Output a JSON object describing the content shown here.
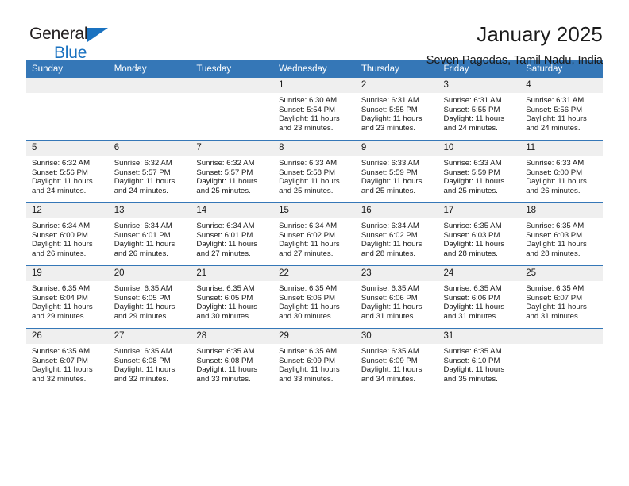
{
  "brand": {
    "line1": "General",
    "line2": "Blue",
    "mark": "triangle-logo"
  },
  "header": {
    "title": "January 2025",
    "subtitle": "Seven Pagodas, Tamil Nadu, India"
  },
  "colors": {
    "header_blue": "#3577b7",
    "daynum_gray": "#efefef",
    "brand_blue": "#1a72c0",
    "text": "#1a1a1a"
  },
  "weekday_headers": [
    "Sunday",
    "Monday",
    "Tuesday",
    "Wednesday",
    "Thursday",
    "Friday",
    "Saturday"
  ],
  "labels": {
    "sunrise": "Sunrise:",
    "sunset": "Sunset:",
    "daylight": "Daylight:"
  },
  "weeks": [
    [
      {
        "day": "",
        "empty": true
      },
      {
        "day": "",
        "empty": true
      },
      {
        "day": "",
        "empty": true
      },
      {
        "day": "1",
        "sunrise": "Sunrise: 6:30 AM",
        "sunset": "Sunset: 5:54 PM",
        "daylight": "Daylight: 11 hours and 23 minutes."
      },
      {
        "day": "2",
        "sunrise": "Sunrise: 6:31 AM",
        "sunset": "Sunset: 5:55 PM",
        "daylight": "Daylight: 11 hours and 23 minutes."
      },
      {
        "day": "3",
        "sunrise": "Sunrise: 6:31 AM",
        "sunset": "Sunset: 5:55 PM",
        "daylight": "Daylight: 11 hours and 24 minutes."
      },
      {
        "day": "4",
        "sunrise": "Sunrise: 6:31 AM",
        "sunset": "Sunset: 5:56 PM",
        "daylight": "Daylight: 11 hours and 24 minutes."
      }
    ],
    [
      {
        "day": "5",
        "sunrise": "Sunrise: 6:32 AM",
        "sunset": "Sunset: 5:56 PM",
        "daylight": "Daylight: 11 hours and 24 minutes."
      },
      {
        "day": "6",
        "sunrise": "Sunrise: 6:32 AM",
        "sunset": "Sunset: 5:57 PM",
        "daylight": "Daylight: 11 hours and 24 minutes."
      },
      {
        "day": "7",
        "sunrise": "Sunrise: 6:32 AM",
        "sunset": "Sunset: 5:57 PM",
        "daylight": "Daylight: 11 hours and 25 minutes."
      },
      {
        "day": "8",
        "sunrise": "Sunrise: 6:33 AM",
        "sunset": "Sunset: 5:58 PM",
        "daylight": "Daylight: 11 hours and 25 minutes."
      },
      {
        "day": "9",
        "sunrise": "Sunrise: 6:33 AM",
        "sunset": "Sunset: 5:59 PM",
        "daylight": "Daylight: 11 hours and 25 minutes."
      },
      {
        "day": "10",
        "sunrise": "Sunrise: 6:33 AM",
        "sunset": "Sunset: 5:59 PM",
        "daylight": "Daylight: 11 hours and 25 minutes."
      },
      {
        "day": "11",
        "sunrise": "Sunrise: 6:33 AM",
        "sunset": "Sunset: 6:00 PM",
        "daylight": "Daylight: 11 hours and 26 minutes."
      }
    ],
    [
      {
        "day": "12",
        "sunrise": "Sunrise: 6:34 AM",
        "sunset": "Sunset: 6:00 PM",
        "daylight": "Daylight: 11 hours and 26 minutes."
      },
      {
        "day": "13",
        "sunrise": "Sunrise: 6:34 AM",
        "sunset": "Sunset: 6:01 PM",
        "daylight": "Daylight: 11 hours and 26 minutes."
      },
      {
        "day": "14",
        "sunrise": "Sunrise: 6:34 AM",
        "sunset": "Sunset: 6:01 PM",
        "daylight": "Daylight: 11 hours and 27 minutes."
      },
      {
        "day": "15",
        "sunrise": "Sunrise: 6:34 AM",
        "sunset": "Sunset: 6:02 PM",
        "daylight": "Daylight: 11 hours and 27 minutes."
      },
      {
        "day": "16",
        "sunrise": "Sunrise: 6:34 AM",
        "sunset": "Sunset: 6:02 PM",
        "daylight": "Daylight: 11 hours and 28 minutes."
      },
      {
        "day": "17",
        "sunrise": "Sunrise: 6:35 AM",
        "sunset": "Sunset: 6:03 PM",
        "daylight": "Daylight: 11 hours and 28 minutes."
      },
      {
        "day": "18",
        "sunrise": "Sunrise: 6:35 AM",
        "sunset": "Sunset: 6:03 PM",
        "daylight": "Daylight: 11 hours and 28 minutes."
      }
    ],
    [
      {
        "day": "19",
        "sunrise": "Sunrise: 6:35 AM",
        "sunset": "Sunset: 6:04 PM",
        "daylight": "Daylight: 11 hours and 29 minutes."
      },
      {
        "day": "20",
        "sunrise": "Sunrise: 6:35 AM",
        "sunset": "Sunset: 6:05 PM",
        "daylight": "Daylight: 11 hours and 29 minutes."
      },
      {
        "day": "21",
        "sunrise": "Sunrise: 6:35 AM",
        "sunset": "Sunset: 6:05 PM",
        "daylight": "Daylight: 11 hours and 30 minutes."
      },
      {
        "day": "22",
        "sunrise": "Sunrise: 6:35 AM",
        "sunset": "Sunset: 6:06 PM",
        "daylight": "Daylight: 11 hours and 30 minutes."
      },
      {
        "day": "23",
        "sunrise": "Sunrise: 6:35 AM",
        "sunset": "Sunset: 6:06 PM",
        "daylight": "Daylight: 11 hours and 31 minutes."
      },
      {
        "day": "24",
        "sunrise": "Sunrise: 6:35 AM",
        "sunset": "Sunset: 6:06 PM",
        "daylight": "Daylight: 11 hours and 31 minutes."
      },
      {
        "day": "25",
        "sunrise": "Sunrise: 6:35 AM",
        "sunset": "Sunset: 6:07 PM",
        "daylight": "Daylight: 11 hours and 31 minutes."
      }
    ],
    [
      {
        "day": "26",
        "sunrise": "Sunrise: 6:35 AM",
        "sunset": "Sunset: 6:07 PM",
        "daylight": "Daylight: 11 hours and 32 minutes."
      },
      {
        "day": "27",
        "sunrise": "Sunrise: 6:35 AM",
        "sunset": "Sunset: 6:08 PM",
        "daylight": "Daylight: 11 hours and 32 minutes."
      },
      {
        "day": "28",
        "sunrise": "Sunrise: 6:35 AM",
        "sunset": "Sunset: 6:08 PM",
        "daylight": "Daylight: 11 hours and 33 minutes."
      },
      {
        "day": "29",
        "sunrise": "Sunrise: 6:35 AM",
        "sunset": "Sunset: 6:09 PM",
        "daylight": "Daylight: 11 hours and 33 minutes."
      },
      {
        "day": "30",
        "sunrise": "Sunrise: 6:35 AM",
        "sunset": "Sunset: 6:09 PM",
        "daylight": "Daylight: 11 hours and 34 minutes."
      },
      {
        "day": "31",
        "sunrise": "Sunrise: 6:35 AM",
        "sunset": "Sunset: 6:10 PM",
        "daylight": "Daylight: 11 hours and 35 minutes."
      },
      {
        "day": "",
        "empty": true
      }
    ]
  ]
}
